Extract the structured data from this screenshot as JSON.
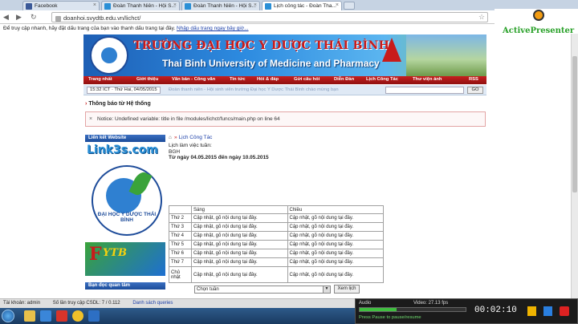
{
  "browser": {
    "tabs": [
      {
        "label": "Facebook"
      },
      {
        "label": "Đoàn Thanh Niên - Hội S..."
      },
      {
        "label": "Đoàn Thanh Niên - Hội S..."
      },
      {
        "label": "Lịch công tác - Đoàn Tha..."
      }
    ],
    "url": "doanhoi.svydtb.edu.vn/lichct/",
    "infobar": {
      "text": "Để truy cập nhanh, hãy đặt dấu trang của bạn vào thanh dấu trang tại đây.",
      "link": "Nhập dấu trang ngay bây giờ..."
    }
  },
  "recorder_logo": {
    "name": "ActivePresenter"
  },
  "site": {
    "title_vi": "TRƯỜNG ĐẠI HỌC Y DƯỢC THÁI BÌNH",
    "title_en": "Thai Binh University of Medicine and Pharmacy",
    "nav": [
      "Trang nhất",
      "Giới thiệu",
      "Văn bản - Công văn",
      "Tin tức",
      "Hỏi & đáp",
      "Gửi câu hỏi",
      "Diễn Đàn",
      "Lịch Công Tác",
      "Thư viện ảnh",
      "RSS"
    ],
    "date_text": "15:32 ICT · Thứ Hai, 04/05/2015",
    "marquee": "Đoàn thanh niên - Hội sinh viên trường Đại học Y Dược Thái Bình chào mừng bạn",
    "search_btn": "GO",
    "notice_title": "Thông báo từ Hệ thống",
    "notice_text": "Notice: Undefined variable: title in file /modules/lichct/funcs/main.php on line 64"
  },
  "sidebar": {
    "links_header": "Liên kết Website",
    "link3s": "Link3s.com",
    "seal_text": "ĐẠI HỌC Y DƯỢC THÁI BÌNH",
    "ytb_text": "YTB",
    "readers_header": "Bạn đọc quan tâm"
  },
  "schedule": {
    "breadcrumb": "Lịch Công Tác",
    "line1": "Lịch làm việc tuần:",
    "line2": "BGH",
    "line3": "Từ ngày 04.05.2015 đến ngày 10.05.2015",
    "headers": [
      "",
      "Sáng",
      "Chiều"
    ],
    "rows": [
      {
        "day": "Thứ 2",
        "am": "Cập nhật, gõ nội dung tại đây.",
        "pm": "Cập nhật, gõ nội dung tại đây."
      },
      {
        "day": "Thứ 3",
        "am": "Cập nhật, gõ nội dung tại đây.",
        "pm": "Cập nhật, gõ nội dung tại đây."
      },
      {
        "day": "Thứ 4",
        "am": "Cập nhật, gõ nội dung tại đây.",
        "pm": "Cập nhật, gõ nội dung tại đây."
      },
      {
        "day": "Thứ 5",
        "am": "Cập nhật, gõ nội dung tại đây.",
        "pm": "Cập nhật, gõ nội dung tại đây."
      },
      {
        "day": "Thứ 6",
        "am": "Cập nhật, gõ nội dung tại đây.",
        "pm": "Cập nhật, gõ nội dung tại đây."
      },
      {
        "day": "Thứ 7",
        "am": "Cập nhật, gõ nội dung tại đây.",
        "pm": "Cập nhật, gõ nội dung tại đây."
      },
      {
        "day": "Chủ nhật",
        "am": "Cập nhật, gõ nội dung tại đây.",
        "pm": "Cập nhật, gõ nội dung tại đây."
      }
    ],
    "select_value": "Chọn tuần",
    "view_btn": "Xem lịch"
  },
  "statusbar": {
    "login": "Tài khoản: admin",
    "queries": "Số lần truy cập CSDL: 7 / 0.112",
    "link": "Danh sách queries"
  },
  "recorder": {
    "audio_label": "Audio",
    "video_label": "Video: 27.13 fps",
    "hint": "Press Pause to pause/resume",
    "time": "00:02:10"
  }
}
